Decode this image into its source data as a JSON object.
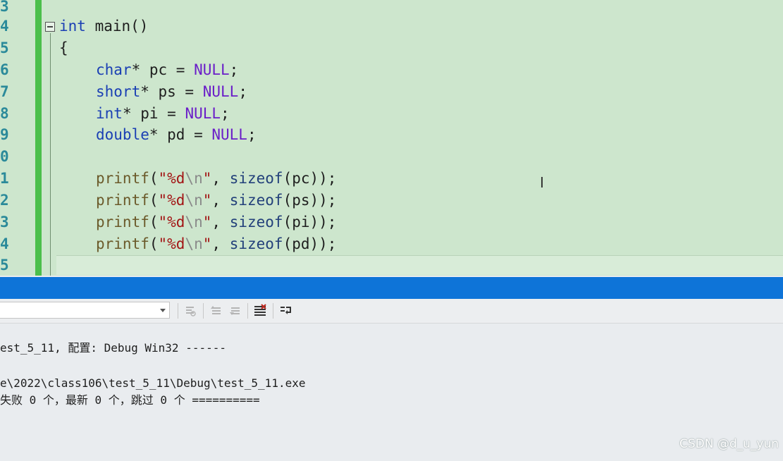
{
  "editor": {
    "line_numbers": [
      "3",
      "4",
      "5",
      "6",
      "7",
      "8",
      "9",
      "0",
      "1",
      "2",
      "3",
      "4",
      "5"
    ],
    "code": {
      "main_kw": "int",
      "main_name": " main()",
      "open_brace": "{",
      "decls": [
        {
          "type": "char",
          "rest": "* pc = ",
          "val": "NULL",
          "end": ";"
        },
        {
          "type": "short",
          "rest": "* ps = ",
          "val": "NULL",
          "end": ";"
        },
        {
          "type": "int",
          "rest": "* pi = ",
          "val": "NULL",
          "end": ";"
        },
        {
          "type": "double",
          "rest": "* pd = ",
          "val": "NULL",
          "end": ";"
        }
      ],
      "prints": [
        {
          "fn": "printf",
          "p1": "(",
          "fmt": "\"%d",
          "esc": "\\n",
          "q": "\"",
          "comma": ", ",
          "sz": "sizeof",
          "arg": "(pc));"
        },
        {
          "fn": "printf",
          "p1": "(",
          "fmt": "\"%d",
          "esc": "\\n",
          "q": "\"",
          "comma": ", ",
          "sz": "sizeof",
          "arg": "(ps));"
        },
        {
          "fn": "printf",
          "p1": "(",
          "fmt": "\"%d",
          "esc": "\\n",
          "q": "\"",
          "comma": ", ",
          "sz": "sizeof",
          "arg": "(pi));"
        },
        {
          "fn": "printf",
          "p1": "(",
          "fmt": "\"%d",
          "esc": "\\n",
          "q": "\"",
          "comma": ", ",
          "sz": "sizeof",
          "arg": "(pd));"
        }
      ]
    },
    "colors": {
      "background": "#cde6cd",
      "change_bar": "#4bbf4b",
      "keyword": "#1a3fb4",
      "macro": "#6a1ec8",
      "string": "#a31515"
    }
  },
  "output_panel": {
    "titlebar_color": "#0e74d8",
    "source_value": "",
    "lines": [
      "est_5_11, 配置: Debug Win32 ------",
      "e\\2022\\class106\\test_5_11\\Debug\\test_5_11.exe",
      "失败 0 个，最新 0 个，跳过 0 个 =========="
    ],
    "toolbar_icons": [
      "find-message-icon",
      "prev-message-icon",
      "next-message-icon",
      "clear-all-icon",
      "toggle-word-wrap-icon"
    ]
  },
  "watermark": "CSDN @d_u_yun"
}
